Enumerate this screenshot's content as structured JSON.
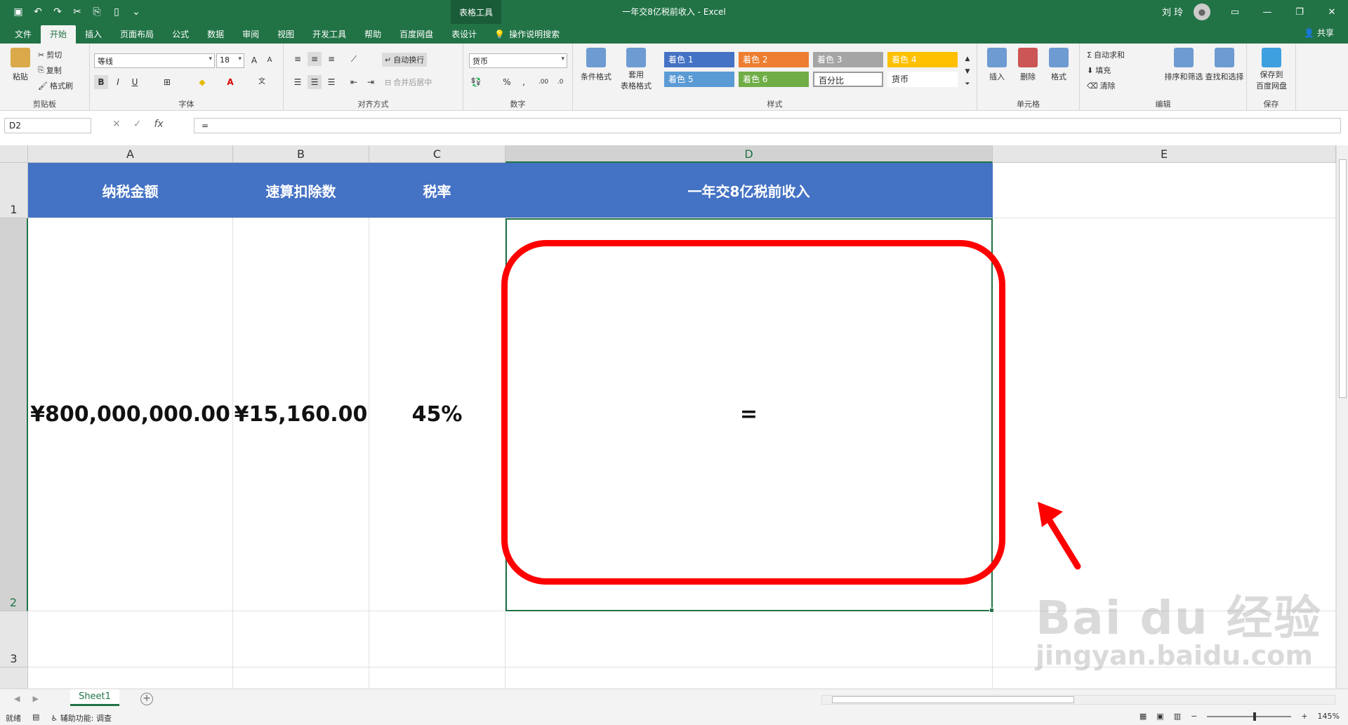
{
  "titlebar": {
    "context_tools": "表格工具",
    "doc_title": "一年交8亿税前收入 - Excel",
    "user_name": "刘 玲",
    "qat_icons": [
      "save-icon",
      "undo-icon",
      "redo-icon",
      "cut-icon",
      "screenshot-icon",
      "new-file-icon",
      "customize-icon"
    ]
  },
  "tabs": {
    "items": [
      "文件",
      "开始",
      "插入",
      "页面布局",
      "公式",
      "数据",
      "审阅",
      "视图",
      "开发工具",
      "帮助",
      "百度网盘",
      "表设计"
    ],
    "active": "开始",
    "tell_me": "操作说明搜索",
    "share": "共享"
  },
  "ribbon": {
    "clipboard": {
      "paste": "粘贴",
      "cut": "剪切",
      "copy": "复制",
      "format_painter": "格式刷",
      "label": "剪贴板"
    },
    "font": {
      "name": "等线",
      "size": "18",
      "bold": "B",
      "italic": "I",
      "underline": "U",
      "label": "字体"
    },
    "alignment": {
      "wrap": "自动换行",
      "merge": "合并后居中",
      "label": "对齐方式"
    },
    "number": {
      "format": "货币",
      "percent": "%",
      "comma": ",",
      "label": "数字"
    },
    "styles": {
      "conditional": "条件格式",
      "table_format_1": "套用",
      "table_format_2": "表格格式",
      "cells": [
        {
          "name": "着色 1",
          "color": "#4472c4"
        },
        {
          "name": "着色 2",
          "color": "#ed7d31"
        },
        {
          "name": "着色 3",
          "color": "#a5a5a5"
        },
        {
          "name": "着色 4",
          "color": "#ffc000"
        },
        {
          "name": "着色 5",
          "color": "#5b9bd5"
        },
        {
          "name": "着色 6",
          "color": "#70ad47"
        },
        {
          "name": "百分比",
          "color": "#ffffff"
        },
        {
          "name": "货币",
          "color": "#ffffff"
        }
      ],
      "label": "样式"
    },
    "cells_group": {
      "insert": "插入",
      "delete": "删除",
      "format": "格式",
      "label": "单元格"
    },
    "editing": {
      "autosum": "自动求和",
      "fill": "填充",
      "clear": "清除",
      "sort": "排序和筛选",
      "find": "查找和选择",
      "label": "编辑"
    },
    "save": {
      "line1": "保存到",
      "line2": "百度网盘",
      "label": "保存"
    }
  },
  "formula_bar": {
    "name_box": "D2",
    "cancel": "✕",
    "enter": "✓",
    "fx": "fx",
    "formula": "="
  },
  "grid": {
    "columns": [
      "A",
      "B",
      "C",
      "D",
      "E"
    ],
    "selected_column": "D",
    "rows": [
      "1",
      "2",
      "3"
    ],
    "selected_row": "2",
    "header": [
      "纳税金额",
      "速算扣除数",
      "税率",
      "一年交8亿税前收入"
    ],
    "values": [
      "¥800,000,000.00",
      "¥15,160.00",
      "45%",
      "="
    ],
    "header_color": "#4472c4",
    "annotation_color": "#ff0000"
  },
  "watermark": {
    "brand": "Bai du 经验",
    "url": "jingyan.baidu.com"
  },
  "sheets": {
    "items": [
      "Sheet1"
    ],
    "active": "Sheet1"
  },
  "status": {
    "ready": "就绪",
    "accessibility": "辅助功能: 调查",
    "zoom": "145%"
  }
}
